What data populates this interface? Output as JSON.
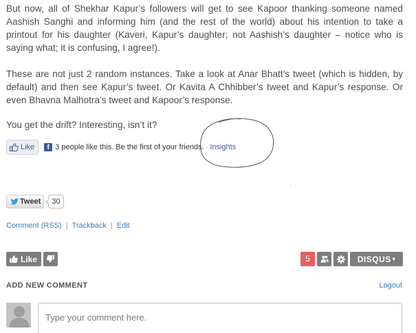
{
  "article": {
    "paragraph1": "But now, all of Shekhar Kapur’s followers will get to see Kapoor thanking someone named Aashish Sanghi and informing him (and the rest of the world) about his intention to take a printout for his daughter (Kaveri, Kapur’s daughter; not Aashish’s daughter – notice who is saying what; it is confusing, I agree!).",
    "paragraph2": "These are not just 2 random instances. Take a look at Anar Bhatt’s tweet (which is hidden, by default) and then see Kapur’s tweet. Or Kavita A Chhibber’s tweet and Kapur’s response. Or even Bhavna Malhotra’s tweet and Kapoor’s response.",
    "paragraph3": "You get the drift? Interesting, isn’t it?"
  },
  "facebook": {
    "like_label": "Like",
    "social_text": "3 people like this. Be the first of your friends.",
    "separator": "·",
    "insights_label": "Insights",
    "brand_color": "#3b5998"
  },
  "twitter": {
    "tweet_label": "Tweet",
    "count": "30"
  },
  "post_links": {
    "comment_rss": "Comment (RSS)",
    "trackback": "Trackback",
    "edit": "Edit",
    "separator": "|"
  },
  "disqus": {
    "like_label": "Like",
    "comment_count": "5",
    "logo_text": "DISQUS",
    "count_color": "#e85f5f",
    "button_color": "#7d7d7d"
  },
  "comments": {
    "heading": "ADD NEW COMMENT",
    "logout_label": "Logout",
    "placeholder": "Type your comment here."
  }
}
